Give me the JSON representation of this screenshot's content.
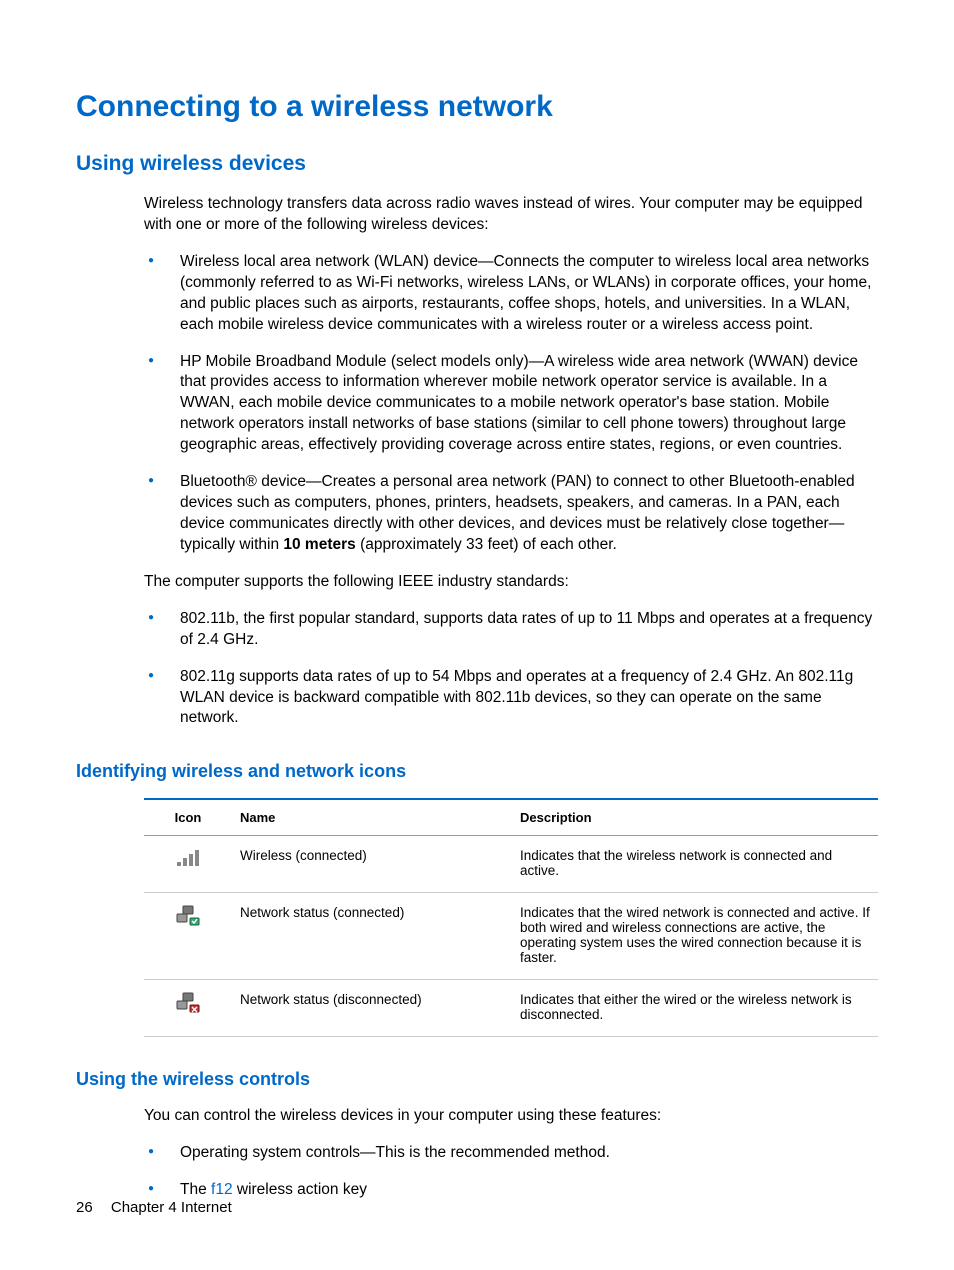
{
  "h1": "Connecting to a wireless network",
  "h2_1": "Using wireless devices",
  "p1": "Wireless technology transfers data across radio waves instead of wires. Your computer may be equipped with one or more of the following wireless devices:",
  "b1": "Wireless local area network (WLAN) device—Connects the computer to wireless local area networks (commonly referred to as Wi-Fi networks, wireless LANs, or WLANs) in corporate offices, your home, and public places such as airports, restaurants, coffee shops, hotels, and universities. In a WLAN, each mobile wireless device communicates with a wireless router or a wireless access point.",
  "b2": "HP Mobile Broadband Module (select models only)—A wireless wide area network (WWAN) device that provides access to information wherever mobile network operator service is available. In a WWAN, each mobile device communicates to a mobile network operator's base station. Mobile network operators install networks of base stations (similar to cell phone towers) throughout large geographic areas, effectively providing coverage across entire states, regions, or even countries.",
  "b3_pre": "Bluetooth® device—Creates a personal area network (PAN) to connect to other Bluetooth-enabled devices such as computers, phones, printers, headsets, speakers, and cameras. In a PAN, each device communicates directly with other devices, and devices must be relatively close together— typically within ",
  "b3_bold": "10 meters",
  "b3_post": " (approximately 33 feet) of each other.",
  "p2": "The computer supports the following IEEE industry standards:",
  "b4": "802.11b, the first popular standard, supports data rates of up to 11 Mbps and operates at a frequency of 2.4 GHz.",
  "b5": "802.11g supports data rates of up to 54 Mbps and operates at a frequency of 2.4 GHz. An 802.11g WLAN device is backward compatible with 802.11b devices, so they can operate on the same network.",
  "h3_1": "Identifying wireless and network icons",
  "table": {
    "headers": {
      "icon": "Icon",
      "name": "Name",
      "desc": "Description"
    },
    "rows": [
      {
        "name": "Wireless (connected)",
        "desc": "Indicates that the wireless network is connected and active."
      },
      {
        "name": "Network status (connected)",
        "desc": "Indicates that the wired network is connected and active. If both wired and wireless connections are active, the operating system uses the wired connection because it is faster."
      },
      {
        "name": "Network status (disconnected)",
        "desc": "Indicates that either the wired or the wireless network is disconnected."
      }
    ]
  },
  "h3_2": "Using the wireless controls",
  "p3": "You can control the wireless devices in your computer using these features:",
  "b6": "Operating system controls—This is the recommended method.",
  "b7_pre": "The ",
  "b7_key": "f12",
  "b7_post": " wireless action key",
  "footer": {
    "page": "26",
    "chapter": "Chapter 4   Internet"
  }
}
